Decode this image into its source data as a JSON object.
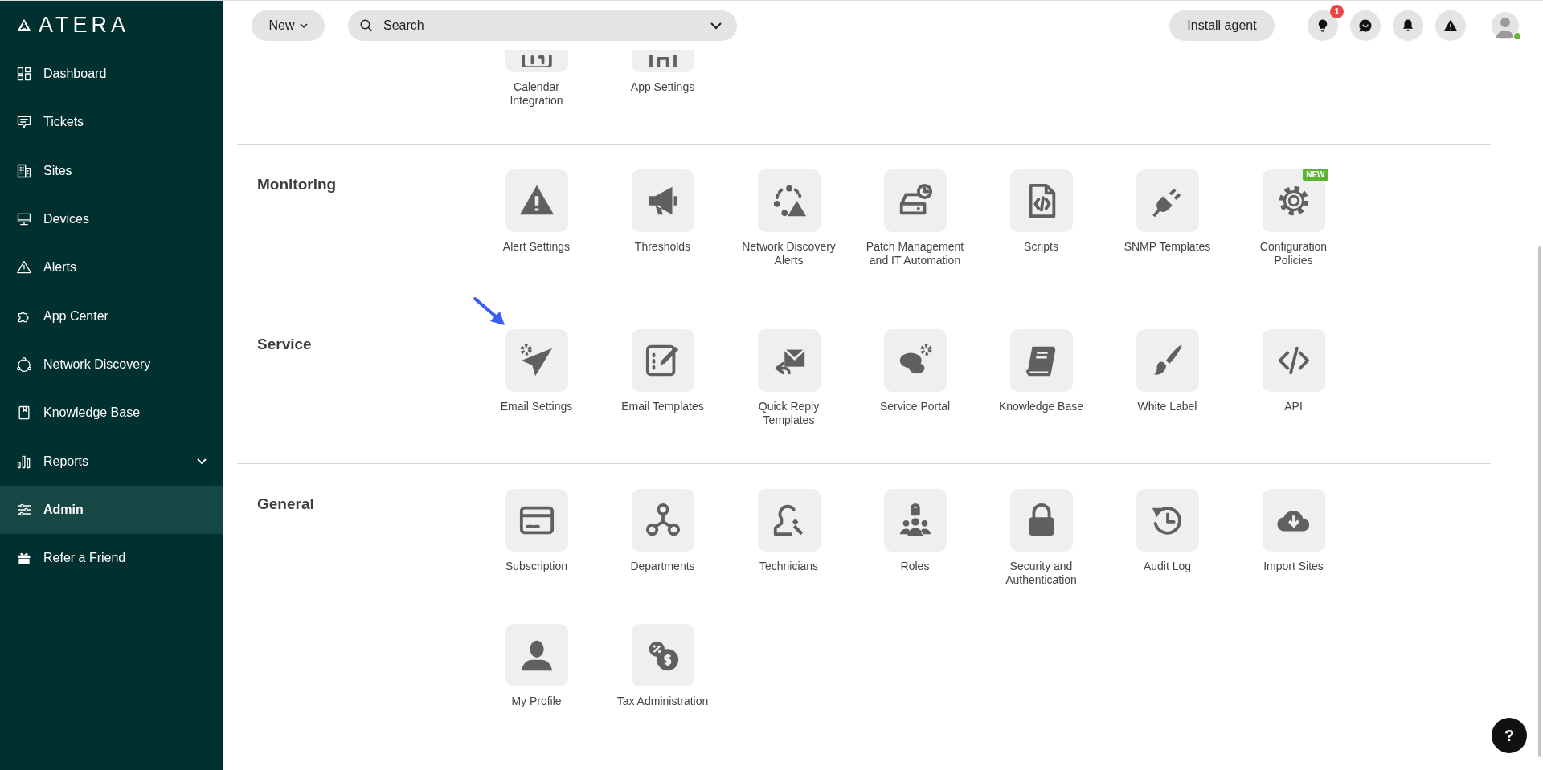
{
  "sidebar": {
    "logo": "ATERA",
    "items": [
      {
        "label": "Dashboard",
        "kind": "link",
        "selected": false
      },
      {
        "label": "Tickets",
        "kind": "link",
        "selected": false
      },
      {
        "label": "Sites",
        "kind": "link",
        "selected": false
      },
      {
        "label": "Devices",
        "kind": "link",
        "selected": false
      },
      {
        "label": "Alerts",
        "kind": "link",
        "selected": false
      },
      {
        "label": "App Center",
        "kind": "link",
        "selected": false
      },
      {
        "label": "Network Discovery",
        "kind": "link",
        "selected": false
      },
      {
        "label": "Knowledge Base",
        "kind": "link",
        "selected": false
      },
      {
        "label": "Reports",
        "kind": "group",
        "expanded": false,
        "selected": false
      },
      {
        "label": "Admin",
        "kind": "link",
        "selected": true
      },
      {
        "label": "Refer a Friend",
        "kind": "link",
        "selected": false
      }
    ]
  },
  "header": {
    "new_button": "New",
    "search": {
      "placeholder": "Search"
    },
    "install_button": "Install agent",
    "tips_badge": "1",
    "user_online": true
  },
  "sections": [
    {
      "tiles": [
        {
          "label": "Calendar Integration"
        },
        {
          "label": "App Settings"
        }
      ]
    },
    {
      "title": "Monitoring",
      "tiles": [
        {
          "label": "Alert Settings"
        },
        {
          "label": "Thresholds"
        },
        {
          "label": "Network Discovery Alerts"
        },
        {
          "label": "Patch Management and IT Automation"
        },
        {
          "label": "Scripts"
        },
        {
          "label": "SNMP Templates"
        },
        {
          "label": "Configuration Policies",
          "badge": "NEW"
        }
      ]
    },
    {
      "title": "Service",
      "tiles": [
        {
          "label": "Email Settings"
        },
        {
          "label": "Email Templates"
        },
        {
          "label": "Quick Reply Templates"
        },
        {
          "label": "Service Portal"
        },
        {
          "label": "Knowledge Base"
        },
        {
          "label": "White Label"
        },
        {
          "label": "API"
        }
      ]
    },
    {
      "title": "General",
      "tiles": [
        {
          "label": "Subscription"
        },
        {
          "label": "Departments"
        },
        {
          "label": "Technicians"
        },
        {
          "label": "Roles"
        },
        {
          "label": "Security and Authentication"
        },
        {
          "label": "Audit Log"
        },
        {
          "label": "Import Sites"
        },
        {
          "label": "My Profile"
        },
        {
          "label": "Tax Administration"
        }
      ]
    }
  ],
  "help_button": "?"
}
